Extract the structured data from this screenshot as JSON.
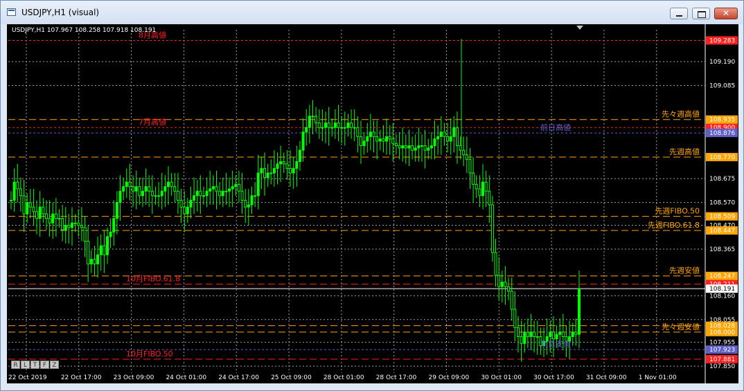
{
  "window": {
    "title": "USDJPY,H1 (visual)"
  },
  "info": {
    "text": "USDJPY,H1  107.967 108.258 107.918 108.191"
  },
  "timeframe_buttons": [
    "R",
    "L",
    "T",
    "F",
    "Z"
  ],
  "colors": {
    "background": "#000000",
    "candle": "#00ff00",
    "grid": "#c0c0c0",
    "red": "#ff2020",
    "orange": "#ffa500",
    "blue": "#5f5fc8",
    "white": "#ffffff"
  },
  "chart_data": {
    "type": "candlestick",
    "symbol": "USDJPY",
    "timeframe": "H1",
    "ylim": [
      107.82,
      109.33
    ],
    "grid": true,
    "y_ticks": [
      109.19,
      109.085,
      108.675,
      108.57,
      108.47,
      108.365,
      108.16,
      108.055,
      107.955,
      107.85
    ],
    "y_tick_labels": [
      "109.190",
      "109.085",
      "108.675",
      "108.570",
      "108.470",
      "108.365",
      "108.160",
      "108.055",
      "107.955",
      "107.850"
    ],
    "x_labels": [
      "22 Oct 2019",
      "22 Oct 17:00",
      "23 Oct 09:00",
      "24 Oct 01:00",
      "24 Oct 17:00",
      "25 Oct 09:00",
      "28 Oct 01:00",
      "28 Oct 17:00",
      "29 Oct 09:00",
      "30 Oct 01:00",
      "30 Oct 17:00",
      "31 Oct 09:00",
      "1 Nov 01:00"
    ],
    "price_levels": [
      {
        "price": 109.283,
        "label": "109.283",
        "color": "red",
        "dash": "short"
      },
      {
        "price": 108.9,
        "label": "108.900",
        "color": "red",
        "dash": "short"
      },
      {
        "price": 108.935,
        "label": "108.935",
        "color": "orange",
        "dash": "long"
      },
      {
        "price": 108.876,
        "label": "108.876",
        "color": "blue",
        "dash": "short"
      },
      {
        "price": 108.77,
        "label": "108.770",
        "color": "orange",
        "dash": "long"
      },
      {
        "price": 108.509,
        "label": "108.509",
        "color": "orange",
        "dash": "long"
      },
      {
        "price": 108.447,
        "label": "108.447",
        "color": "orange",
        "dash": "long"
      },
      {
        "price": 108.247,
        "label": "108.247",
        "color": "orange",
        "dash": "long"
      },
      {
        "price": 108.211,
        "label": "108.211",
        "color": "red",
        "dash": "long"
      },
      {
        "price": 108.191,
        "label": "108.191",
        "color": "white",
        "dash": "solid"
      },
      {
        "price": 108.028,
        "label": "108.028",
        "color": "orange",
        "dash": "long"
      },
      {
        "price": 108.0,
        "label": "108.000",
        "color": "orange",
        "dash": "long"
      },
      {
        "price": 107.923,
        "label": "107.923",
        "color": "blue",
        "dash": "short"
      },
      {
        "price": 107.881,
        "label": "107.881",
        "color": "red",
        "dash": "long"
      }
    ],
    "annotations": [
      {
        "text": "8月高値",
        "price": 109.283,
        "side": "left",
        "color": "red"
      },
      {
        "text": "7月高値",
        "price": 108.9,
        "side": "left",
        "color": "red"
      },
      {
        "text": "先々週高値",
        "price": 108.935,
        "side": "right",
        "color": "orange"
      },
      {
        "text": "前日高値",
        "price": 108.876,
        "side": "mid",
        "color": "blue"
      },
      {
        "text": "先週高値",
        "price": 108.77,
        "side": "right",
        "color": "orange"
      },
      {
        "text": "先週FIBO.50",
        "price": 108.509,
        "side": "right",
        "color": "orange"
      },
      {
        "text": "先週FIBO.61.8",
        "price": 108.447,
        "side": "right",
        "color": "orange"
      },
      {
        "text": "先週安値",
        "price": 108.247,
        "side": "right",
        "color": "orange"
      },
      {
        "text": "10月FIBO.61.8",
        "price": 108.211,
        "side": "left",
        "color": "red"
      },
      {
        "text": "先々週安値",
        "price": 108.0,
        "side": "right",
        "color": "orange"
      },
      {
        "text": "前日安値",
        "price": 107.923,
        "side": "mid",
        "color": "blue"
      },
      {
        "text": "10月FIBO.50",
        "price": 107.881,
        "side": "left",
        "color": "red"
      }
    ],
    "series": [
      {
        "name": "USDJPY",
        "close": [
          108.58,
          108.66,
          108.63,
          108.6,
          108.52,
          108.57,
          108.55,
          108.53,
          108.5,
          108.55,
          108.52,
          108.5,
          108.48,
          108.52,
          108.5,
          108.5,
          108.45,
          108.47,
          108.46,
          108.48,
          108.48,
          108.47,
          108.46,
          108.4,
          108.3,
          108.32,
          108.3,
          108.34,
          108.38,
          108.34,
          108.42,
          108.44,
          108.5,
          108.57,
          108.62,
          108.64,
          108.66,
          108.64,
          108.62,
          108.64,
          108.6,
          108.62,
          108.64,
          108.62,
          108.6,
          108.6,
          108.6,
          108.62,
          108.64,
          108.66,
          108.64,
          108.62,
          108.58,
          108.55,
          108.52,
          108.55,
          108.58,
          108.6,
          108.62,
          108.6,
          108.6,
          108.62,
          108.63,
          108.64,
          108.62,
          108.6,
          108.62,
          108.62,
          108.63,
          108.64,
          108.65,
          108.62,
          108.58,
          108.55,
          108.56,
          108.6,
          108.6,
          108.7,
          108.72,
          108.68,
          108.7,
          108.7,
          108.72,
          108.74,
          108.75,
          108.74,
          108.72,
          108.7,
          108.72,
          108.75,
          108.8,
          108.88,
          108.9,
          108.95,
          108.95,
          108.92,
          108.9,
          108.9,
          108.92,
          108.9,
          108.9,
          108.92,
          108.9,
          108.9,
          108.9,
          108.92,
          108.9,
          108.9,
          108.86,
          108.82,
          108.84,
          108.86,
          108.88,
          108.86,
          108.84,
          108.85,
          108.84,
          108.86,
          108.85,
          108.83,
          108.82,
          108.81,
          108.82,
          108.81,
          108.82,
          108.8,
          108.81,
          108.82,
          108.82,
          108.8,
          108.81,
          108.82,
          108.85,
          108.86,
          108.88,
          108.86,
          108.84,
          108.86,
          108.9,
          108.82,
          108.8,
          108.78,
          108.76,
          108.7,
          108.65,
          108.63,
          108.6,
          108.66,
          108.62,
          108.56,
          108.35,
          108.25,
          108.2,
          108.22,
          108.2,
          108.18,
          108.1,
          108.02,
          107.98,
          107.95,
          108.0,
          107.98,
          108.0,
          107.98,
          107.98,
          107.94,
          107.96,
          107.98,
          108.0,
          107.97,
          107.99,
          108.0,
          107.98,
          107.96,
          107.98,
          108.0,
          107.99,
          108.19
        ]
      }
    ]
  }
}
